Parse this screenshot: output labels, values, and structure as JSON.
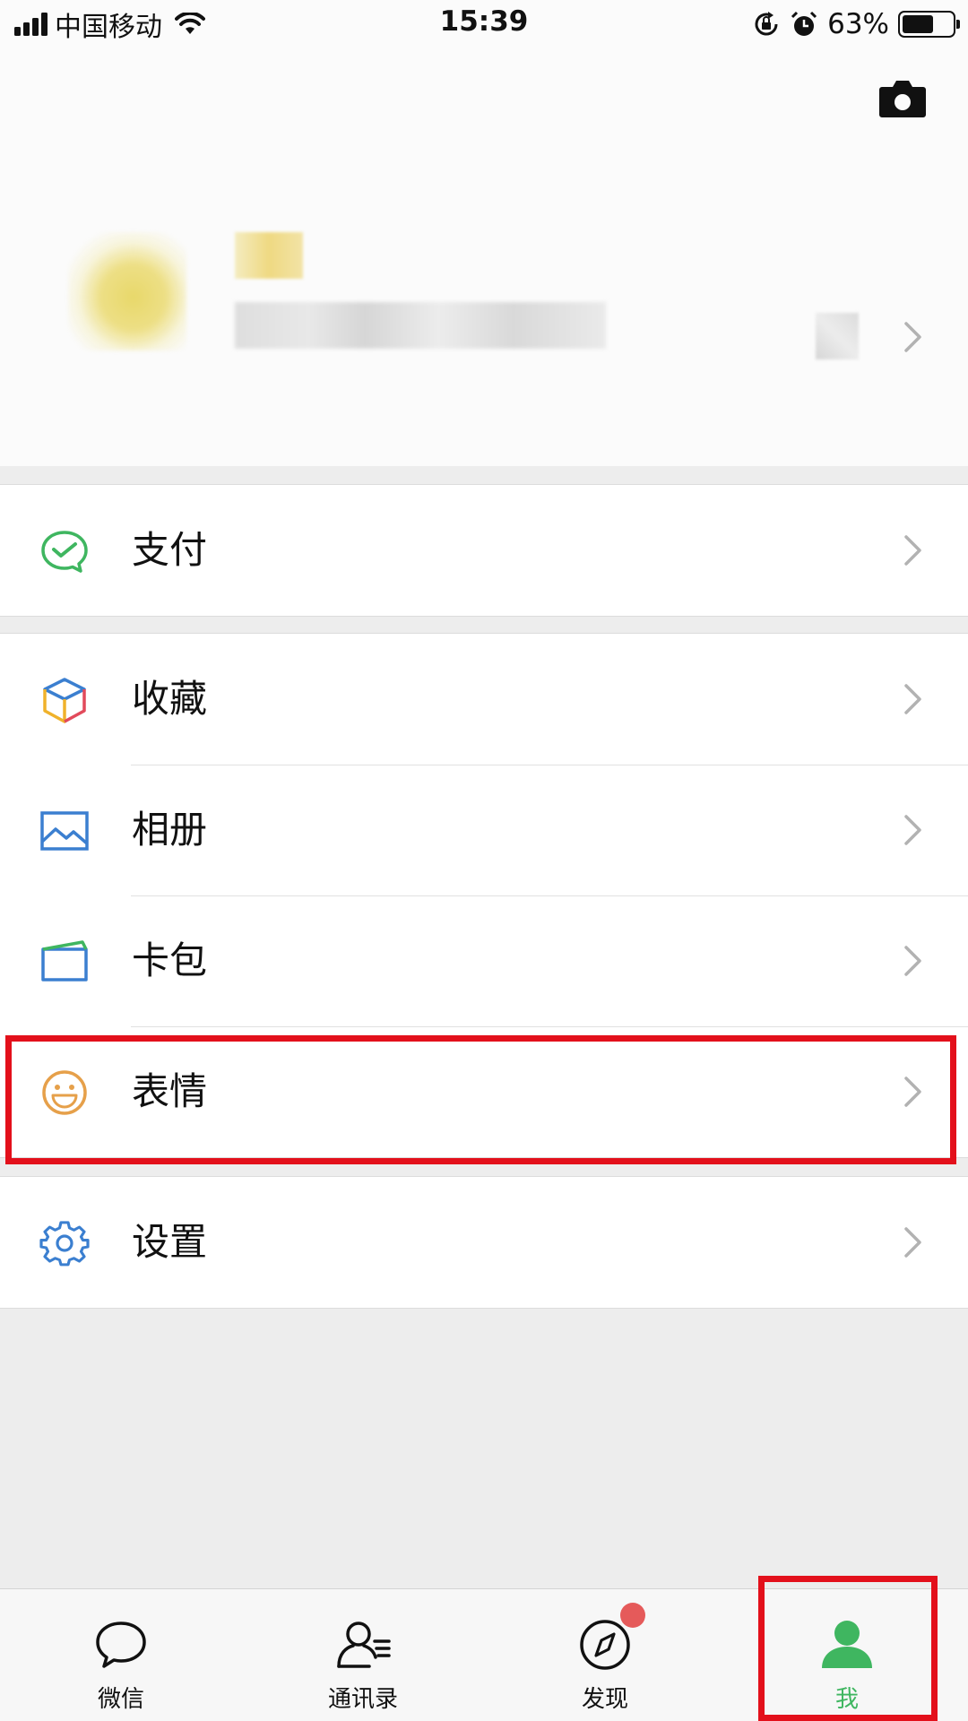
{
  "status_bar": {
    "carrier": "中国移动",
    "time": "15:39",
    "battery_percent": "63%",
    "battery_level": 0.63
  },
  "profile": {
    "chevron_icon": "chevron-right-icon",
    "camera_icon": "camera-icon"
  },
  "menu": {
    "group1": [
      {
        "label": "支付",
        "icon": "wechat-pay-icon"
      }
    ],
    "group2": [
      {
        "label": "收藏",
        "icon": "favorites-cube-icon"
      },
      {
        "label": "相册",
        "icon": "album-icon"
      },
      {
        "label": "卡包",
        "icon": "card-wallet-icon"
      },
      {
        "label": "表情",
        "icon": "sticker-smile-icon"
      }
    ],
    "group3": [
      {
        "label": "设置",
        "icon": "settings-gear-icon"
      }
    ]
  },
  "tab_bar": {
    "tabs": [
      {
        "label": "微信",
        "icon": "chat-bubble-icon",
        "active": false
      },
      {
        "label": "通讯录",
        "icon": "contacts-icon",
        "active": false
      },
      {
        "label": "发现",
        "icon": "discover-compass-icon",
        "active": false,
        "badge": true
      },
      {
        "label": "我",
        "icon": "me-person-icon",
        "active": true
      }
    ]
  },
  "colors": {
    "accent_green": "#3fb660",
    "highlight_red": "#e3101b",
    "badge_red": "#e55a5a"
  }
}
